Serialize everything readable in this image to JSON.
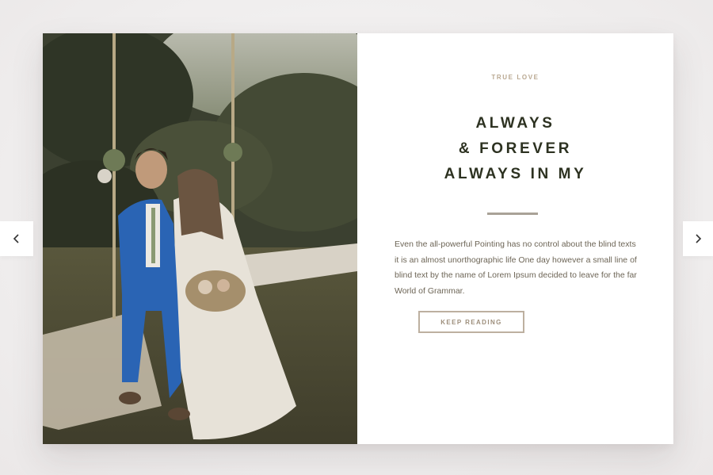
{
  "slide": {
    "eyebrow": "TRUE LOVE",
    "headline": [
      "ALWAYS",
      "& FOREVER",
      "ALWAYS IN MY"
    ],
    "body": "Even the all-powerful Pointing has no control about the blind texts it is an almost unorthographic life One day however a small line of blind text by the name of Lorem Ipsum decided to leave for the far World of Grammar.",
    "button_label": "KEEP READING"
  },
  "nav": {
    "prev_icon": "chevron-left-icon",
    "next_icon": "chevron-right-icon"
  },
  "colors": {
    "headline": "#2d3221",
    "eyebrow": "#b9a891",
    "body": "#6d6556",
    "button_border": "#bdb0a0",
    "suit_accent": "#2a64b4"
  }
}
